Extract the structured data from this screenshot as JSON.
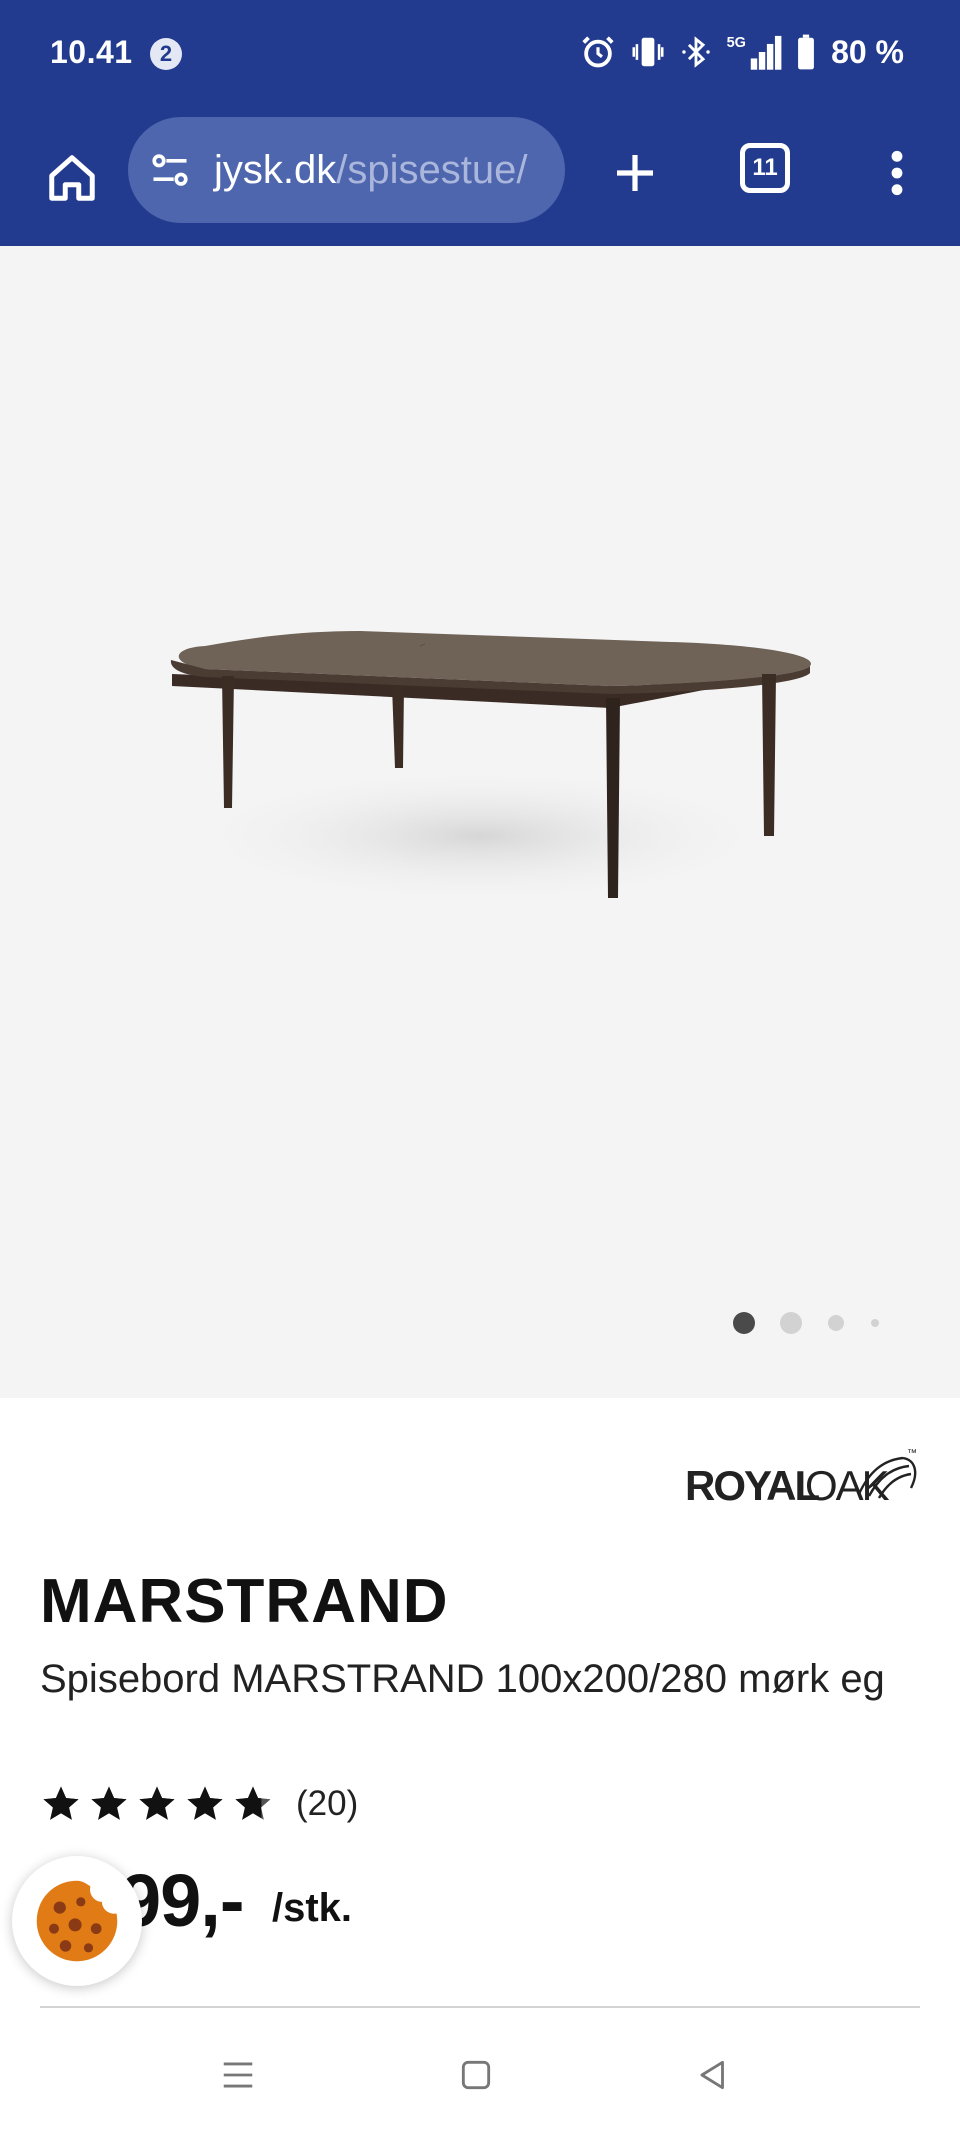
{
  "status_bar": {
    "time": "10.41",
    "notification_count": "2",
    "network": "5G",
    "battery": "80 %"
  },
  "browser": {
    "url_domain": "jysk.dk",
    "url_path": "/spisestue/",
    "tab_count": "11"
  },
  "gallery": {
    "image_name": "spisebord-marstrand-table",
    "slide_count": 4,
    "active_slide": 1
  },
  "product": {
    "brand": "ROYALOAK",
    "brand_part1": "ROYAL",
    "brand_part2": "OAK",
    "brand_tm": "™",
    "title": "MARSTRAND",
    "description": "Spisebord MARSTRAND 100x200/280 mørk eg",
    "rating_value": 4.7,
    "rating_count": "(20)",
    "price": "99,-",
    "price_unit": "/stk."
  },
  "colors": {
    "header": "#233b8e",
    "url_bar": "#4e66ad",
    "gallery_bg": "#f4f4f4",
    "cookie": "#e07b16"
  },
  "icons": {
    "home": "home-icon",
    "site_settings": "tune-icon",
    "new_tab": "plus-icon",
    "menu": "more-vert-icon",
    "cookie": "cookie-icon",
    "nav_recent": "recent-apps-icon",
    "nav_home": "nav-home-icon",
    "nav_back": "back-icon"
  }
}
